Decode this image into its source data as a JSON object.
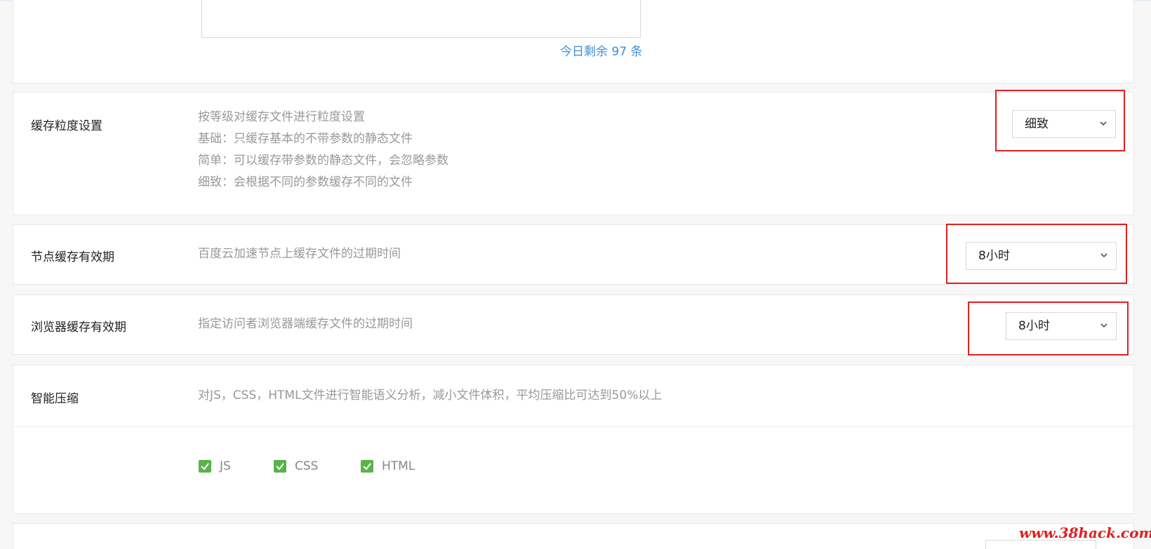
{
  "top_section": {
    "remaining_text": "今日剩余 97 条"
  },
  "cache_granularity": {
    "label": "缓存粒度设置",
    "desc_lines": [
      "按等级对缓存文件进行粒度设置",
      "基础：只缓存基本的不带参数的静态文件",
      "简单：可以缓存带参数的静态文件，会忽略参数",
      "细致：会根据不同的参数缓存不同的文件"
    ],
    "selected": "细致"
  },
  "node_cache_ttl": {
    "label": "节点缓存有效期",
    "desc": "百度云加速节点上缓存文件的过期时间",
    "selected": "8小时"
  },
  "browser_cache_ttl": {
    "label": "浏览器缓存有效期",
    "desc": "指定访问者浏览器端缓存文件的过期时间",
    "selected": "8小时"
  },
  "smart_compress": {
    "label": "智能压缩",
    "desc": "对JS，CSS，HTML文件进行智能语义分析，减小文件体积，平均压缩比可达到50%以上",
    "options": [
      {
        "label": "JS",
        "checked": true
      },
      {
        "label": "CSS",
        "checked": true
      },
      {
        "label": "HTML",
        "checked": true
      }
    ]
  },
  "watermark": "www.38hack.com",
  "colors": {
    "highlight_border": "#e02020",
    "link": "#3c8ee0",
    "checkbox": "#59b34a"
  }
}
